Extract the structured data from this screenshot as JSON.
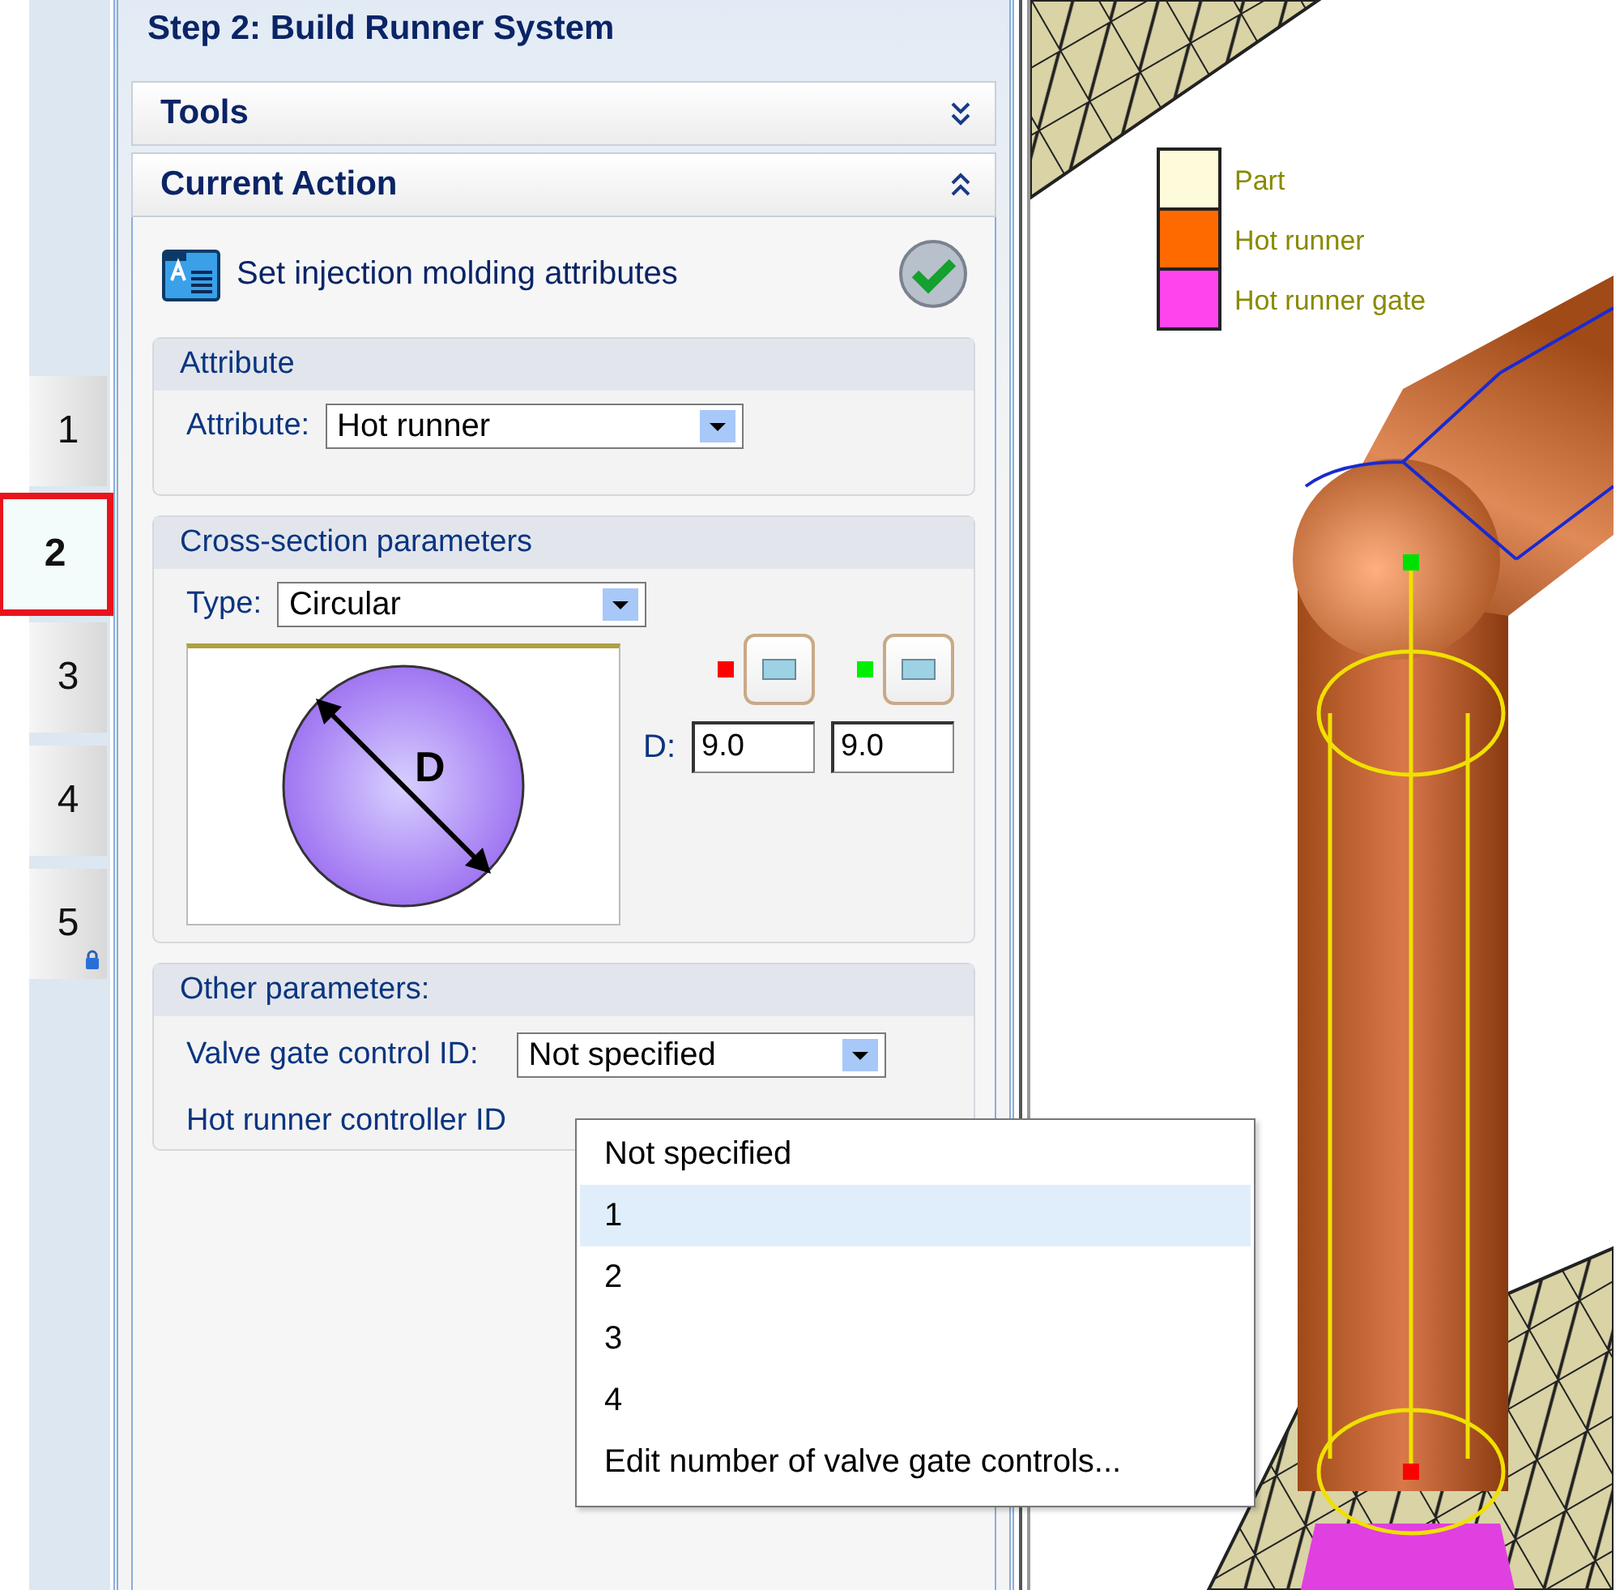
{
  "steps": [
    {
      "label": "1",
      "selected": false,
      "locked": false
    },
    {
      "label": "2",
      "selected": true,
      "locked": false
    },
    {
      "label": "3",
      "selected": false,
      "locked": false
    },
    {
      "label": "4",
      "selected": false,
      "locked": false
    },
    {
      "label": "5",
      "selected": false,
      "locked": true
    }
  ],
  "panel": {
    "title": "Step 2: Build Runner System",
    "sections": [
      {
        "label": "Tools",
        "expanded": false
      },
      {
        "label": "Current Action",
        "expanded": true
      }
    ],
    "action": {
      "label": "Set injection molding attributes"
    },
    "attribute_group": {
      "title": "Attribute",
      "label": "Attribute:",
      "value": "Hot runner"
    },
    "cross_section": {
      "title": "Cross-section parameters",
      "type_label": "Type:",
      "type_value": "Circular",
      "diagram_label": "D",
      "d_label": "D:",
      "ends": [
        {
          "color": "#ff0000",
          "value": "9.0"
        },
        {
          "color": "#00ee00",
          "value": "9.0"
        }
      ]
    },
    "other": {
      "title": "Other parameters:",
      "fields": [
        {
          "label": "Valve gate control ID:",
          "value": "Not specified"
        },
        {
          "label": "Hot runner controller ID"
        }
      ]
    },
    "dropdown": {
      "options": [
        {
          "label": "Not specified",
          "selected": false
        },
        {
          "label": "1",
          "selected": true
        },
        {
          "label": "2",
          "selected": false
        },
        {
          "label": "3",
          "selected": false
        },
        {
          "label": "4",
          "selected": false
        },
        {
          "label": "Edit number of valve gate controls...",
          "selected": false
        }
      ]
    }
  },
  "legend": [
    {
      "label": "Part",
      "color": "#fdfbd9"
    },
    {
      "label": "Hot runner",
      "color": "#ff6a00"
    },
    {
      "label": "Hot runner gate",
      "color": "#ff44ee"
    }
  ]
}
